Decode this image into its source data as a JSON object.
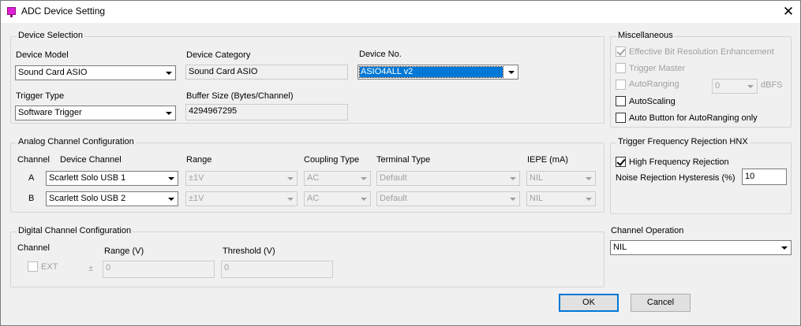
{
  "window": {
    "title": "ADC Device Setting"
  },
  "device_selection": {
    "title": "Device Selection",
    "model_label": "Device Model",
    "model_value": "Sound Card ASIO",
    "category_label": "Device Category",
    "category_value": "Sound Card ASIO",
    "device_no_label": "Device No.",
    "device_no_value": "ASIO4ALL v2",
    "trigger_label": "Trigger Type",
    "trigger_value": "Software Trigger",
    "buffer_label": "Buffer Size (Bytes/Channel)",
    "buffer_value": "4294967295"
  },
  "misc": {
    "title": "Miscellaneous",
    "ebre": "Effective Bit Resolution Enhancement",
    "trigger_master": "Trigger Master",
    "autoranging": "AutoRanging",
    "autoranging_value": "0",
    "dbfs": "dBFS",
    "autoscaling": "AutoScaling",
    "auto_button": "Auto Button for AutoRanging only"
  },
  "analog": {
    "title": "Analog Channel Configuration",
    "headers": {
      "channel": "Channel",
      "device_channel": "Device Channel",
      "range": "Range",
      "coupling": "Coupling Type",
      "terminal": "Terminal Type",
      "iepe": "IEPE (mA)"
    },
    "rows": [
      {
        "channel": "A",
        "device_channel": "Scarlett Solo USB 1",
        "range": "±1V",
        "coupling": "AC",
        "terminal": "Default",
        "iepe": "NIL"
      },
      {
        "channel": "B",
        "device_channel": "Scarlett Solo USB 2",
        "range": "±1V",
        "coupling": "AC",
        "terminal": "Default",
        "iepe": "NIL"
      }
    ]
  },
  "hnx": {
    "title": "Trigger Frequency Rejection HNX",
    "high_freq": "High Frequency Rejection",
    "noise_label": "Noise Rejection Hysteresis (%)",
    "noise_value": "10"
  },
  "digital": {
    "title": "Digital Channel Configuration",
    "channel_label": "Channel",
    "ext": "EXT",
    "range_label": "Range (V)",
    "pm": "±",
    "range_value": "0",
    "threshold_label": "Threshold (V)",
    "threshold_value": "0"
  },
  "channel_operation": {
    "label": "Channel Operation",
    "value": "NIL"
  },
  "buttons": {
    "ok": "OK",
    "cancel": "Cancel"
  }
}
